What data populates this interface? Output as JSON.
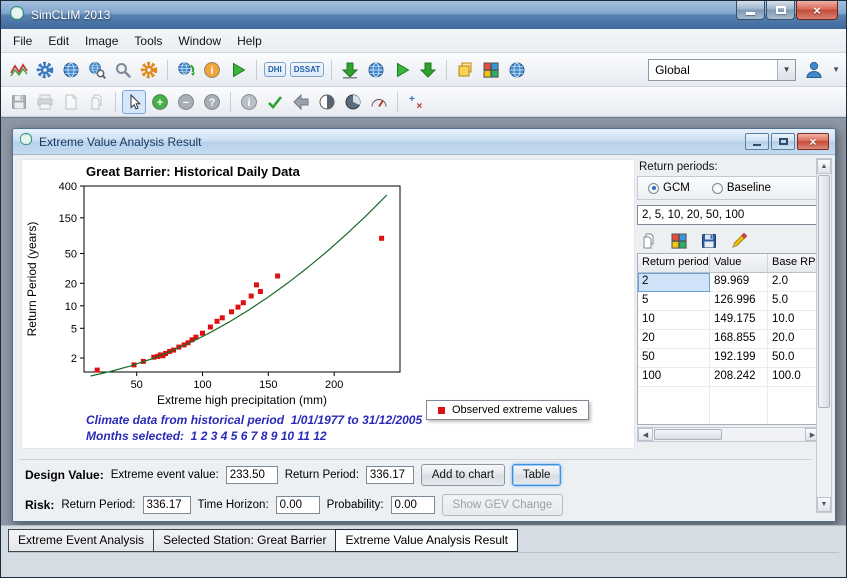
{
  "titlebar": {
    "title": "SimCLIM 2013"
  },
  "menu": {
    "items": [
      "File",
      "Edit",
      "Image",
      "Tools",
      "Window",
      "Help"
    ]
  },
  "toolbar_top": {
    "region_select_value": "Global",
    "icons": [
      {
        "name": "timeseries-chart-icon",
        "kind": "wave"
      },
      {
        "name": "scenario-gear-icon",
        "kind": "gear",
        "color": "#3a7abf"
      },
      {
        "name": "world-map-icon",
        "kind": "globe"
      },
      {
        "name": "area-explore-icon",
        "kind": "globemag"
      },
      {
        "name": "zoom-tool-icon",
        "kind": "mag",
        "color": "#7d8b99"
      },
      {
        "name": "settings-gear-icon",
        "kind": "gear",
        "color": "#e0891e"
      },
      {
        "kind": "sep",
        "name": "toolbar-separator"
      },
      {
        "name": "globe-refresh-icon",
        "kind": "globearrow"
      },
      {
        "name": "site-info-icon",
        "kind": "circlechar",
        "fill": "#f2a33c",
        "char": "i"
      },
      {
        "name": "run-analysis-icon",
        "kind": "tri"
      },
      {
        "kind": "sep",
        "name": "toolbar-separator"
      },
      {
        "name": "dhi-model-badge",
        "kind": "badge",
        "text": "DHI"
      },
      {
        "name": "dssat-model-badge",
        "kind": "badge",
        "text": "DSSAT"
      },
      {
        "kind": "sep",
        "name": "toolbar-separator"
      },
      {
        "name": "import-data-icon",
        "kind": "arrowdown",
        "boxed": true
      },
      {
        "name": "globe-data-icon",
        "kind": "globe"
      },
      {
        "name": "run-scenario-icon",
        "kind": "tri"
      },
      {
        "name": "download-icon",
        "kind": "arrowdown"
      },
      {
        "kind": "sep",
        "name": "toolbar-separator"
      },
      {
        "name": "notes-icon",
        "kind": "notes"
      },
      {
        "name": "legend-colors-icon",
        "kind": "grid4"
      },
      {
        "name": "globe-view-icon",
        "kind": "globe"
      }
    ]
  },
  "toolbar_second": {
    "icons": [
      {
        "name": "save-icon",
        "kind": "floppy",
        "disabled": true
      },
      {
        "name": "print-icon",
        "kind": "printer",
        "disabled": true
      },
      {
        "name": "new-document-icon",
        "kind": "doc",
        "disabled": true
      },
      {
        "name": "copy-icon",
        "kind": "copy",
        "disabled": true
      },
      {
        "kind": "sep",
        "name": "toolbar-separator"
      },
      {
        "name": "select-cursor-icon",
        "kind": "cursor",
        "active": true
      },
      {
        "name": "zoom-in-icon",
        "kind": "circlechar",
        "fill": "#46b146",
        "char": "+"
      },
      {
        "name": "zoom-out-icon",
        "kind": "circlechar",
        "fill": "#a6afb8",
        "char": "−"
      },
      {
        "name": "help-icon",
        "kind": "circlechar",
        "fill": "#a6afb8",
        "char": "?"
      },
      {
        "kind": "sep",
        "name": "toolbar-separator"
      },
      {
        "name": "info-icon",
        "kind": "circlechar",
        "fill": "#b9c0c9",
        "char": "i"
      },
      {
        "name": "verify-icon",
        "kind": "check"
      },
      {
        "name": "undo-icon",
        "kind": "arrowleft"
      },
      {
        "name": "contrast-icon",
        "kind": "half"
      },
      {
        "name": "pie-chart-icon",
        "kind": "pie"
      },
      {
        "name": "gauge-icon",
        "kind": "gauge"
      },
      {
        "kind": "sep",
        "name": "toolbar-separator"
      },
      {
        "name": "grid-edit-icon",
        "kind": "plusx"
      }
    ]
  },
  "child_window": {
    "title": "Extreme Value Analysis Result"
  },
  "chart_data": {
    "type": "scatter",
    "title": "Great Barrier: Historical Daily Data",
    "xlabel": "Extreme high precipitation (mm)",
    "ylabel": "Return Period (years)",
    "x_ticks": [
      50,
      100,
      150,
      200
    ],
    "y_ticks": [
      2,
      5,
      10,
      20,
      50,
      150,
      400
    ],
    "xlim": [
      10,
      250
    ],
    "ylim": [
      1.3,
      400
    ],
    "y_scale": "log",
    "grid": false,
    "point_color": "#dd1111",
    "curve_color": "#1a6b2a",
    "legend_label": "Observed extreme values",
    "legend_position": "bottom-right",
    "series": [
      {
        "name": "Observed extreme values",
        "type": "points",
        "values": [
          [
            20,
            1.38
          ],
          [
            48,
            1.62
          ],
          [
            55,
            1.8
          ],
          [
            63,
            2.05
          ],
          [
            66,
            2.1
          ],
          [
            68,
            2.2
          ],
          [
            70,
            2.15
          ],
          [
            72,
            2.3
          ],
          [
            75,
            2.45
          ],
          [
            78,
            2.55
          ],
          [
            82,
            2.8
          ],
          [
            86,
            3.0
          ],
          [
            89,
            3.2
          ],
          [
            92,
            3.5
          ],
          [
            95,
            3.8
          ],
          [
            100,
            4.3
          ],
          [
            106,
            5.2
          ],
          [
            111,
            6.2
          ],
          [
            115,
            6.9
          ],
          [
            122,
            8.3
          ],
          [
            127,
            9.6
          ],
          [
            131,
            11
          ],
          [
            137,
            13.5
          ],
          [
            141,
            19
          ],
          [
            144,
            15.5
          ],
          [
            157,
            25
          ],
          [
            236,
            80
          ]
        ]
      },
      {
        "name": "GEV fit curve",
        "type": "curve",
        "values": [
          [
            15,
            1.15
          ],
          [
            30,
            1.32
          ],
          [
            45,
            1.56
          ],
          [
            60,
            1.91
          ],
          [
            75,
            2.42
          ],
          [
            90,
            3.18
          ],
          [
            105,
            4.3
          ],
          [
            120,
            6.03
          ],
          [
            135,
            8.74
          ],
          [
            150,
            13.1
          ],
          [
            165,
            20.3
          ],
          [
            180,
            32.6
          ],
          [
            195,
            54.1
          ],
          [
            210,
            92.8
          ],
          [
            225,
            164.8
          ],
          [
            240,
            302
          ]
        ]
      }
    ],
    "footnotes": [
      "Climate data from historical period  1/01/1977 to 31/12/2005",
      "Months selected:  1 2 3 4 5 6 7 8 9 10 11 12"
    ]
  },
  "return_panel": {
    "label": "Return periods:",
    "radios": [
      {
        "label": "GCM",
        "selected": true
      },
      {
        "label": "Baseline",
        "selected": false
      }
    ],
    "input_value": "2, 5, 10, 20, 50, 100",
    "icons": [
      {
        "name": "copy-table-icon",
        "kind": "copy"
      },
      {
        "name": "compute-table-icon",
        "kind": "grid4"
      },
      {
        "name": "save-table-icon",
        "kind": "floppy"
      },
      {
        "name": "edit-values-icon",
        "kind": "pencil"
      }
    ],
    "table": {
      "headers": [
        "Return period",
        "Value",
        "Base RP"
      ],
      "rows": [
        [
          "2",
          "89.969",
          "2.0"
        ],
        [
          "5",
          "126.996",
          "5.0"
        ],
        [
          "10",
          "149.175",
          "10.0"
        ],
        [
          "20",
          "168.855",
          "20.0"
        ],
        [
          "50",
          "192.199",
          "50.0"
        ],
        [
          "100",
          "208.242",
          "100.0"
        ]
      ]
    }
  },
  "design_value": {
    "label": "Design Value:",
    "extreme_event_label": "Extreme event value:",
    "extreme_event_value": "233.50",
    "return_period_label": "Return Period:",
    "return_period_value": "336.17",
    "add_to_chart_button": "Add to chart",
    "table_button": "Table"
  },
  "risk": {
    "label": "Risk:",
    "return_period_label": "Return Period:",
    "return_period_value": "336.17",
    "time_horizon_label": "Time Horizon:",
    "time_horizon_value": "0.00",
    "probability_label": "Probability:",
    "probability_value": "0.00",
    "show_gev_button": "Show GEV Change"
  },
  "bottom_tabs": {
    "items": [
      "Extreme Event Analysis",
      "Selected Station: Great Barrier",
      "Extreme Value Analysis Result"
    ],
    "active_index": 2
  }
}
